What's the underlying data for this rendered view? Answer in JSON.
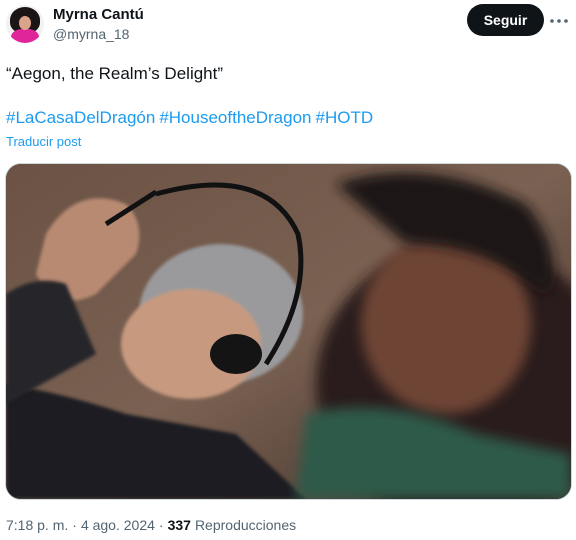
{
  "author": {
    "name": "Myrna Cantú",
    "handle": "@myrna_18"
  },
  "follow_button": {
    "label": "Seguir"
  },
  "post": {
    "text": "“Aegon, the Realm’s Delight”",
    "hashtags": [
      "#LaCasaDelDragón",
      "#HouseoftheDragon",
      "#HOTD"
    ],
    "translate_label": "Traducir post"
  },
  "media": {
    "description_icon": "photo"
  },
  "meta": {
    "time": "7:18 p. m.",
    "separator_1": "·",
    "date": "4 ago. 2024",
    "separator_2": "·",
    "views_count": "337",
    "views_label": "Reproducciones"
  },
  "colors": {
    "link": "#1d9bf0",
    "text": "#0f1419",
    "secondary": "#536471",
    "button_bg": "#0f1419"
  }
}
